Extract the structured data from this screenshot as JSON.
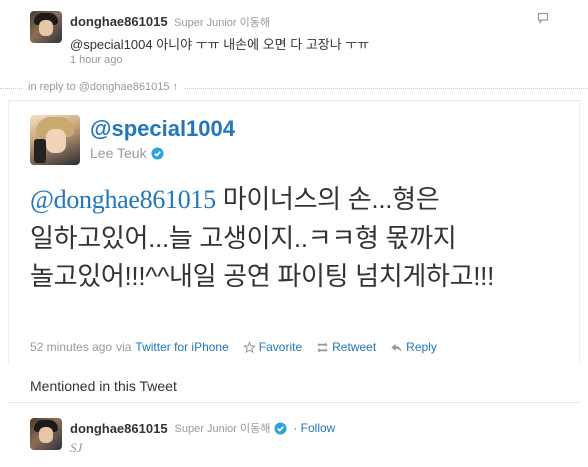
{
  "reply_tweet": {
    "screen_name": "donghae861015",
    "full_name": "Super Junior 이동해",
    "text": "@special1004 아니야 ㅜㅠ 내손에 오면 다 고장나 ㅜㅠ",
    "time": "1 hour ago"
  },
  "in_reply_to": {
    "text": "in reply to @donghae861015 ↑"
  },
  "main_tweet": {
    "screen_name": "@special1004",
    "full_name": "Lee Teuk",
    "mention": "@donghae861015",
    "text": " 마이너스의 손...형은 일하고있어...늘 고생이지..ㅋㅋ형 몫까지 놀고있어!!!^^내일 공연 파이팅 넘치게하고!!!",
    "time": "52 minutes ago",
    "via": "via",
    "source": "Twitter for iPhone",
    "actions": {
      "favorite": "Favorite",
      "retweet": "Retweet",
      "reply": "Reply"
    }
  },
  "mentioned_section": {
    "heading": "Mentioned in this Tweet",
    "user": {
      "screen_name": "donghae861015",
      "full_name": "Super Junior 이동해",
      "follow_label": "· Follow",
      "bio": "SJ"
    }
  },
  "colors": {
    "link": "#2276bb",
    "muted": "#999999",
    "text": "#333333"
  },
  "icons": [
    "comment-icon",
    "verified-icon",
    "favorite-icon",
    "retweet-icon",
    "reply-icon"
  ]
}
